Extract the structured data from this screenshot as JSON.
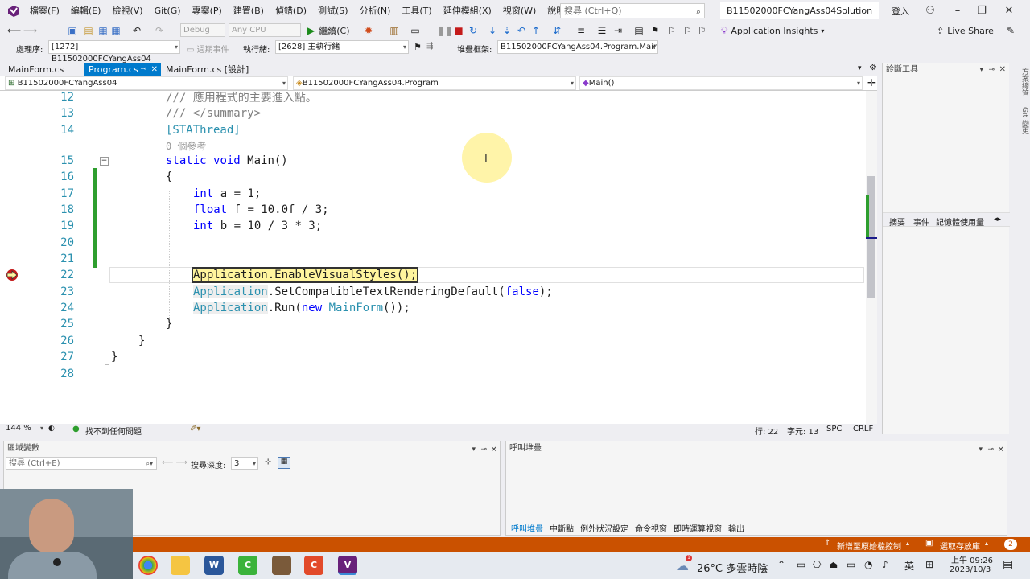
{
  "menu": {
    "items": [
      "檔案(F)",
      "編輯(E)",
      "檢視(V)",
      "Git(G)",
      "專案(P)",
      "建置(B)",
      "偵錯(D)",
      "測試(S)",
      "分析(N)",
      "工具(T)",
      "延伸模組(X)",
      "視窗(W)",
      "說明(H)"
    ],
    "search_placeholder": "搜尋 (Ctrl+Q)",
    "solution_name": "B11502000FCYangAss04Solution",
    "signin": "登入"
  },
  "toolbar1": {
    "config": "Debug",
    "platform": "Any CPU",
    "continue": "繼續(C)",
    "app_insights": "Application Insights",
    "live_share": "Live Share"
  },
  "toolbar2": {
    "process_label": "處理序:",
    "process_value": "[1272] B11502000FCYangAss04",
    "lifecycle": "週期事件",
    "thread_label": "執行緒:",
    "thread_value": "[2628] 主執行緒",
    "stack_label": "堆疊框架:",
    "stack_value": "B11502000FCYangAss04.Program.Mair"
  },
  "tabs": [
    {
      "label": "MainForm.cs",
      "active": false
    },
    {
      "label": "Program.cs",
      "active": true
    },
    {
      "label": "MainForm.cs [設計]",
      "active": false
    }
  ],
  "navbar": {
    "project": "B11502000FCYangAss04",
    "class": "B11502000FCYangAss04.Program",
    "member": "Main()"
  },
  "code_lines": [
    {
      "num": "12",
      "text": "/// 應用程式的主要進入點。",
      "kind": "comment"
    },
    {
      "num": "13",
      "text": "/// </summary>",
      "kind": "comment"
    },
    {
      "num": "14",
      "text": "[STAThread]",
      "kind": "attr"
    },
    {
      "num": "",
      "text": "0 個參考",
      "kind": "ref"
    },
    {
      "num": "15",
      "text": "static void Main()",
      "kind": "decl"
    },
    {
      "num": "16",
      "text": "{",
      "kind": "plain"
    },
    {
      "num": "17",
      "text": "int a = 1;",
      "kind": "int"
    },
    {
      "num": "18",
      "text": "float f = 10.0f / 3;",
      "kind": "float"
    },
    {
      "num": "19",
      "text": "int b = 10 / 3 * 3;",
      "kind": "int"
    },
    {
      "num": "20",
      "text": "",
      "kind": "plain"
    },
    {
      "num": "21",
      "text": "",
      "kind": "plain"
    },
    {
      "num": "22",
      "text": "Application.EnableVisualStyles();",
      "kind": "current"
    },
    {
      "num": "23",
      "text": "Application.SetCompatibleTextRenderingDefault(false);",
      "kind": "app"
    },
    {
      "num": "24",
      "text": "Application.Run(new MainForm());",
      "kind": "app"
    },
    {
      "num": "25",
      "text": "}",
      "kind": "plain"
    },
    {
      "num": "26",
      "text": "}",
      "kind": "plain"
    },
    {
      "num": "27",
      "text": "}",
      "kind": "plain"
    },
    {
      "num": "28",
      "text": "",
      "kind": "plain"
    }
  ],
  "editor_status": {
    "zoom": "144 %",
    "issues": "找不到任何問題",
    "line": "行: 22",
    "col": "字元: 13",
    "spc": "SPC",
    "crlf": "CRLF"
  },
  "diag": {
    "title": "診斷工具",
    "tabs": [
      "摘要",
      "事件",
      "記憶體使用量"
    ],
    "side_labels": [
      "方案總管",
      "Git 變更"
    ]
  },
  "locals": {
    "title": "區域變數",
    "search_placeholder": "搜尋 (Ctrl+E)",
    "depth_label": "搜尋深度:",
    "depth_value": "3"
  },
  "callstack": {
    "title": "呼叫堆疊",
    "tabs": [
      "呼叫堆疊",
      "中斷點",
      "例外狀況設定",
      "命令視窗",
      "即時運算視窗",
      "輸出"
    ]
  },
  "statusbar": {
    "source_control": "新增至原始檔控制",
    "repo": "選取存放庫",
    "notifications": "2"
  },
  "taskbar": {
    "weather": "26°C 多雲時陰",
    "ime": "英",
    "time": "上午 09:26",
    "date": "2023/10/3",
    "notif": "1"
  },
  "colors": {
    "accent": "#007acc",
    "status_orange": "#ca5100",
    "keyword": "#0000ff",
    "type": "#2b91af",
    "comment": "#808080"
  }
}
